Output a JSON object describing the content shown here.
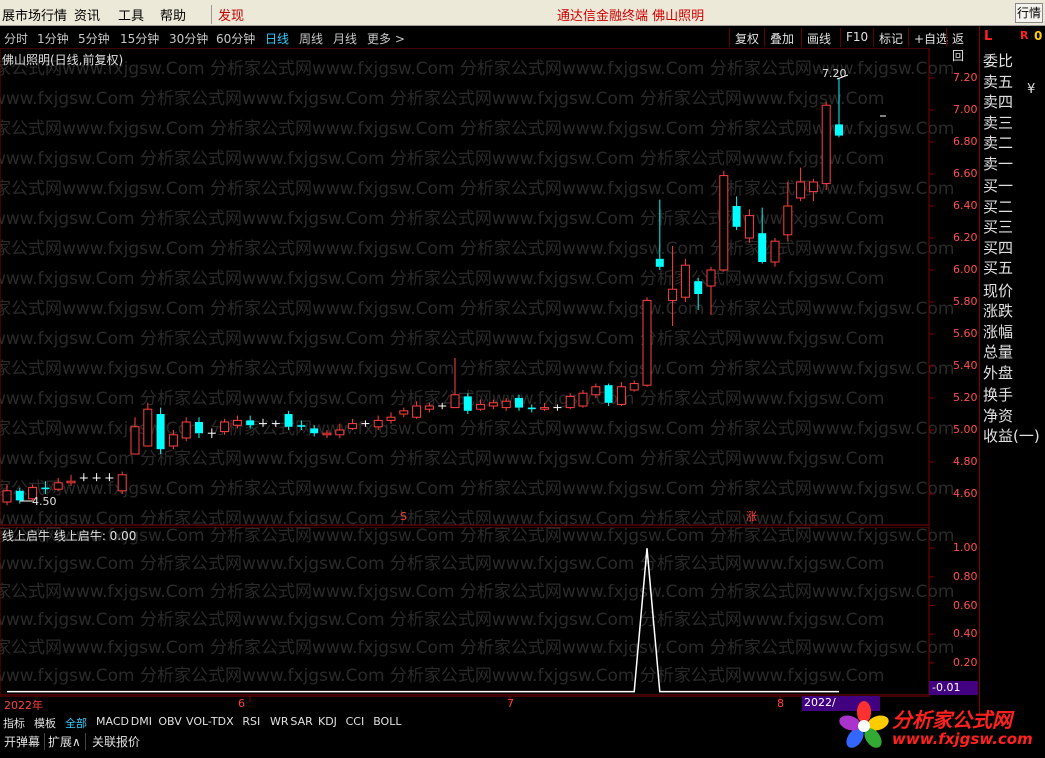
{
  "menubar": {
    "items": [
      "展市场行情",
      "资讯",
      "工具",
      "帮助",
      "发现"
    ],
    "center_title": "通达信金融终端   佛山照明",
    "right_button": "行情"
  },
  "periodbar": {
    "periods": [
      "分时",
      "1分钟",
      "5分钟",
      "15分钟",
      "30分钟",
      "60分钟",
      "日线",
      "周线",
      "月线",
      "更多 >"
    ],
    "active_period": "日线",
    "tools": [
      "复权",
      "叠加",
      "画线",
      "F10",
      "标记",
      "+自选",
      "返回"
    ]
  },
  "main_chart": {
    "title": "佛山照明(日线,前复权)",
    "high_label": "7.20",
    "low_label": "4.50",
    "marker_s": "S",
    "marker_zhang": "涨",
    "y_ticks": [
      "7.20",
      "7.00",
      "6.80",
      "6.60",
      "6.40",
      "6.20",
      "6.00",
      "5.80",
      "5.60",
      "5.40",
      "5.20",
      "5.00",
      "4.80",
      "4.60"
    ],
    "ylim": [
      4.5,
      7.3
    ],
    "watermark": "分析家公式网www.fxjgsw.Com"
  },
  "sub_chart": {
    "title": "线上启牛  线上启牛: 0.00",
    "y_ticks": [
      "1.00",
      "0.80",
      "0.60",
      "0.40",
      "0.20"
    ],
    "current_value": "-0.01"
  },
  "date_axis": {
    "labels": [
      "2022年",
      "6",
      "7",
      "8",
      "2022/"
    ]
  },
  "right_panel": {
    "header_l": "L",
    "header_r": "R",
    "header_0": "0",
    "labels": [
      "委比",
      "卖五",
      "卖四",
      "卖三",
      "卖二",
      "卖一",
      "买一",
      "买二",
      "买三",
      "买四",
      "买五",
      "现价",
      "涨跌",
      "涨幅",
      "总量",
      "外盘",
      "换手",
      "净资",
      "收益(一)"
    ],
    "yen": "¥"
  },
  "tabs": {
    "items": [
      "指标",
      "模板",
      "全部",
      "MACD",
      "DMI",
      "OBV",
      "VOL-TDX",
      "RSI",
      "WR",
      "SAR",
      "KDJ",
      "CCI",
      "BOLL"
    ],
    "active": "全部",
    "row2": [
      "开弹幕",
      "扩展∧",
      "关联报价"
    ]
  },
  "logo": {
    "title": "分析家公式网",
    "url": "www.fxjgsw.com"
  },
  "colors": {
    "up": "#ff4040",
    "down": "#00ffff",
    "flat": "#ffffff",
    "grid": "#800000",
    "axis_text": "#ff5050"
  },
  "chart_data": [
    {
      "type": "candlestick",
      "title": "佛山照明(日线,前复权)",
      "ylim": [
        4.5,
        7.3
      ],
      "candles": [
        [
          4.55,
          4.62,
          4.66,
          4.53
        ],
        [
          4.62,
          4.56,
          4.64,
          4.54
        ],
        [
          4.57,
          4.64,
          4.66,
          4.55
        ],
        [
          4.64,
          4.63,
          4.68,
          4.6
        ],
        [
          4.63,
          4.67,
          4.7,
          4.62
        ],
        [
          4.67,
          4.68,
          4.72,
          4.65
        ],
        [
          4.7,
          4.7,
          4.73,
          4.68
        ],
        [
          4.7,
          4.7,
          4.73,
          4.68
        ],
        [
          4.7,
          4.7,
          4.73,
          4.68
        ],
        [
          4.62,
          4.72,
          4.74,
          4.6
        ],
        [
          4.85,
          5.02,
          5.08,
          4.85
        ],
        [
          4.9,
          5.13,
          5.17,
          4.9
        ],
        [
          5.1,
          4.88,
          5.14,
          4.85
        ],
        [
          4.9,
          4.97,
          5.0,
          4.88
        ],
        [
          4.95,
          5.05,
          5.08,
          4.93
        ],
        [
          5.05,
          4.98,
          5.08,
          4.95
        ],
        [
          4.98,
          4.98,
          5.01,
          4.95
        ],
        [
          4.99,
          5.05,
          5.07,
          4.97
        ],
        [
          5.03,
          5.06,
          5.09,
          5.01
        ],
        [
          5.06,
          5.03,
          5.09,
          5.01
        ],
        [
          5.04,
          5.04,
          5.07,
          5.02
        ],
        [
          5.04,
          5.04,
          5.06,
          5.02
        ],
        [
          5.1,
          5.02,
          5.12,
          5.0
        ],
        [
          5.03,
          5.02,
          5.06,
          5.0
        ],
        [
          5.01,
          4.98,
          5.03,
          4.96
        ],
        [
          4.97,
          4.98,
          5.0,
          4.95
        ],
        [
          4.97,
          5.0,
          5.04,
          4.95
        ],
        [
          5.01,
          5.04,
          5.07,
          5.0
        ],
        [
          5.04,
          5.04,
          5.06,
          5.02
        ],
        [
          5.02,
          5.06,
          5.09,
          5.0
        ],
        [
          5.06,
          5.08,
          5.11,
          5.04
        ],
        [
          5.1,
          5.12,
          5.14,
          5.08
        ],
        [
          5.08,
          5.15,
          5.18,
          5.07
        ],
        [
          5.13,
          5.15,
          5.17,
          5.11
        ],
        [
          5.15,
          5.15,
          5.17,
          5.13
        ],
        [
          5.14,
          5.22,
          5.45,
          5.14
        ],
        [
          5.21,
          5.12,
          5.23,
          5.1
        ],
        [
          5.13,
          5.16,
          5.19,
          5.12
        ],
        [
          5.15,
          5.17,
          5.19,
          5.13
        ],
        [
          5.14,
          5.18,
          5.2,
          5.12
        ],
        [
          5.2,
          5.14,
          5.22,
          5.12
        ],
        [
          5.14,
          5.13,
          5.16,
          5.11
        ],
        [
          5.13,
          5.14,
          5.17,
          5.12
        ],
        [
          5.14,
          5.14,
          5.16,
          5.12
        ],
        [
          5.14,
          5.21,
          5.23,
          5.13
        ],
        [
          5.15,
          5.23,
          5.25,
          5.14
        ],
        [
          5.22,
          5.27,
          5.29,
          5.2
        ],
        [
          5.28,
          5.17,
          5.29,
          5.15
        ],
        [
          5.16,
          5.27,
          5.3,
          5.15
        ],
        [
          5.25,
          5.29,
          5.31,
          5.24
        ],
        [
          5.28,
          5.81,
          5.83,
          5.27
        ],
        [
          6.07,
          6.02,
          6.44,
          6.0
        ],
        [
          5.81,
          5.88,
          6.15,
          5.65
        ],
        [
          5.83,
          6.03,
          6.07,
          5.8
        ],
        [
          5.93,
          5.85,
          5.95,
          5.75
        ],
        [
          5.9,
          6.0,
          6.02,
          5.72
        ],
        [
          6.0,
          6.59,
          6.62,
          5.99
        ],
        [
          6.4,
          6.27,
          6.46,
          6.25
        ],
        [
          6.2,
          6.34,
          6.38,
          6.17
        ],
        [
          6.23,
          6.05,
          6.39,
          6.04
        ],
        [
          6.05,
          6.18,
          6.2,
          6.02
        ],
        [
          6.22,
          6.4,
          6.55,
          6.18
        ],
        [
          6.45,
          6.55,
          6.64,
          6.43
        ],
        [
          6.49,
          6.55,
          6.57,
          6.43
        ],
        [
          6.54,
          7.03,
          7.05,
          6.5
        ],
        [
          6.91,
          6.84,
          7.2,
          6.83
        ]
      ],
      "high_label": "7.20",
      "low_label": "4.50"
    },
    {
      "type": "line",
      "title": "线上启牛",
      "ylim": [
        -0.01,
        1.05
      ],
      "values_by_index": {
        "50": 1.0
      },
      "length": 66
    }
  ]
}
